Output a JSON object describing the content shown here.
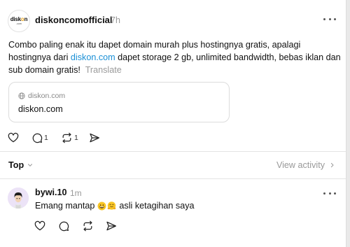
{
  "post": {
    "avatar": {
      "brand_text": "diskon",
      "brand_sub": ".com"
    },
    "username": "diskoncomofficial",
    "time": "7h",
    "more_icon": "more-horizontal-icon",
    "text_before_link": "Combo paling enak itu dapet domain murah plus hostingnya gratis, apalagi hostingnya dari ",
    "link_text": "diskon.com",
    "text_after_link": " dapet storage 2 gb, unlimited bandwidth, bebas iklan dan sub domain gratis!",
    "translate_label": "Translate",
    "link_card": {
      "domain": "diskon.com",
      "title": "diskon.com",
      "icon": "globe-icon"
    },
    "actions": {
      "like_icon": "heart-icon",
      "comment_icon": "comment-icon",
      "comment_count": "1",
      "repost_icon": "repost-icon",
      "repost_count": "1",
      "share_icon": "send-icon"
    }
  },
  "replies_header": {
    "sort_label": "Top",
    "sort_icon": "chevron-down-icon",
    "view_activity_label": "View activity",
    "view_activity_icon": "chevron-right-icon"
  },
  "reply": {
    "username": "bywi.10",
    "time": "1m",
    "text_before_emoji": "Emang mantap",
    "emojis": [
      "grinning-face",
      "hugging-face"
    ],
    "text_after_emoji": "asli ketagihan saya",
    "actions": [
      "heart-icon",
      "comment-icon",
      "repost-icon",
      "send-icon"
    ]
  },
  "colors": {
    "link": "#1a8fd6",
    "muted": "#999999",
    "text": "#101010",
    "border": "#dcdcdc"
  }
}
